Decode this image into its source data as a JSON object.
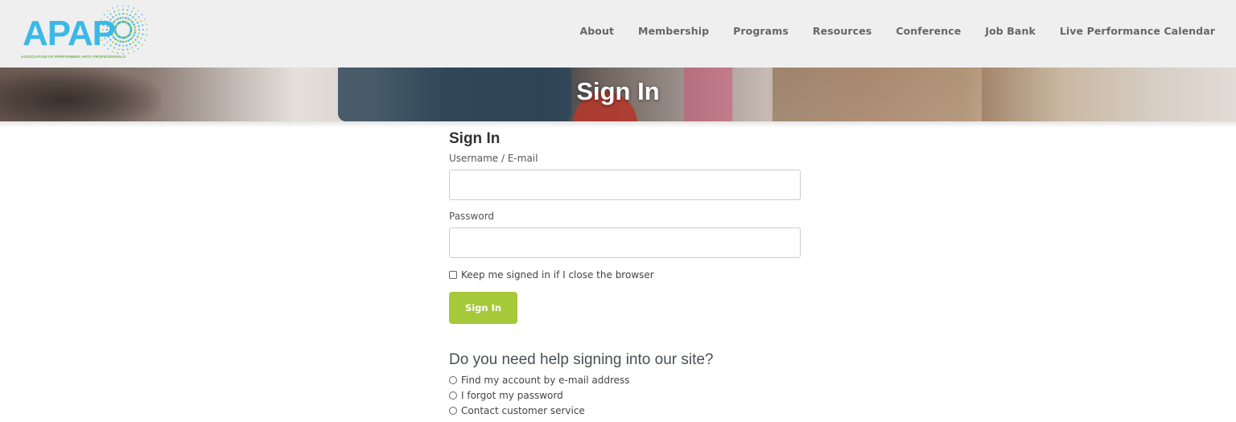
{
  "header": {
    "logo": {
      "text": "APAP",
      "tagline": "ASSOCIATION OF PERFORMING ARTS PROFESSIONALS",
      "colors": {
        "letters": "#3bb8e8",
        "tagline": "#6ab04c",
        "burst_blue": "#3bb8e8",
        "burst_green": "#a6c93a"
      }
    },
    "nav": [
      {
        "label": "About"
      },
      {
        "label": "Membership"
      },
      {
        "label": "Programs"
      },
      {
        "label": "Resources"
      },
      {
        "label": "Conference"
      },
      {
        "label": "Job Bank"
      },
      {
        "label": "Live Performance Calendar"
      }
    ]
  },
  "hero": {
    "title": "Sign In"
  },
  "form": {
    "title": "Sign In",
    "username_label": "Username / E-mail",
    "username_value": "",
    "password_label": "Password",
    "password_value": "",
    "keep_signed_in_label": "Keep me signed in if I close the browser",
    "keep_signed_in_checked": false,
    "submit_label": "Sign In",
    "accent_color": "#a6c93a"
  },
  "help": {
    "title": "Do you need help signing into our site?",
    "options": [
      {
        "label": "Find my account by e-mail address"
      },
      {
        "label": "I forgot my password"
      },
      {
        "label": "Contact customer service"
      }
    ]
  }
}
